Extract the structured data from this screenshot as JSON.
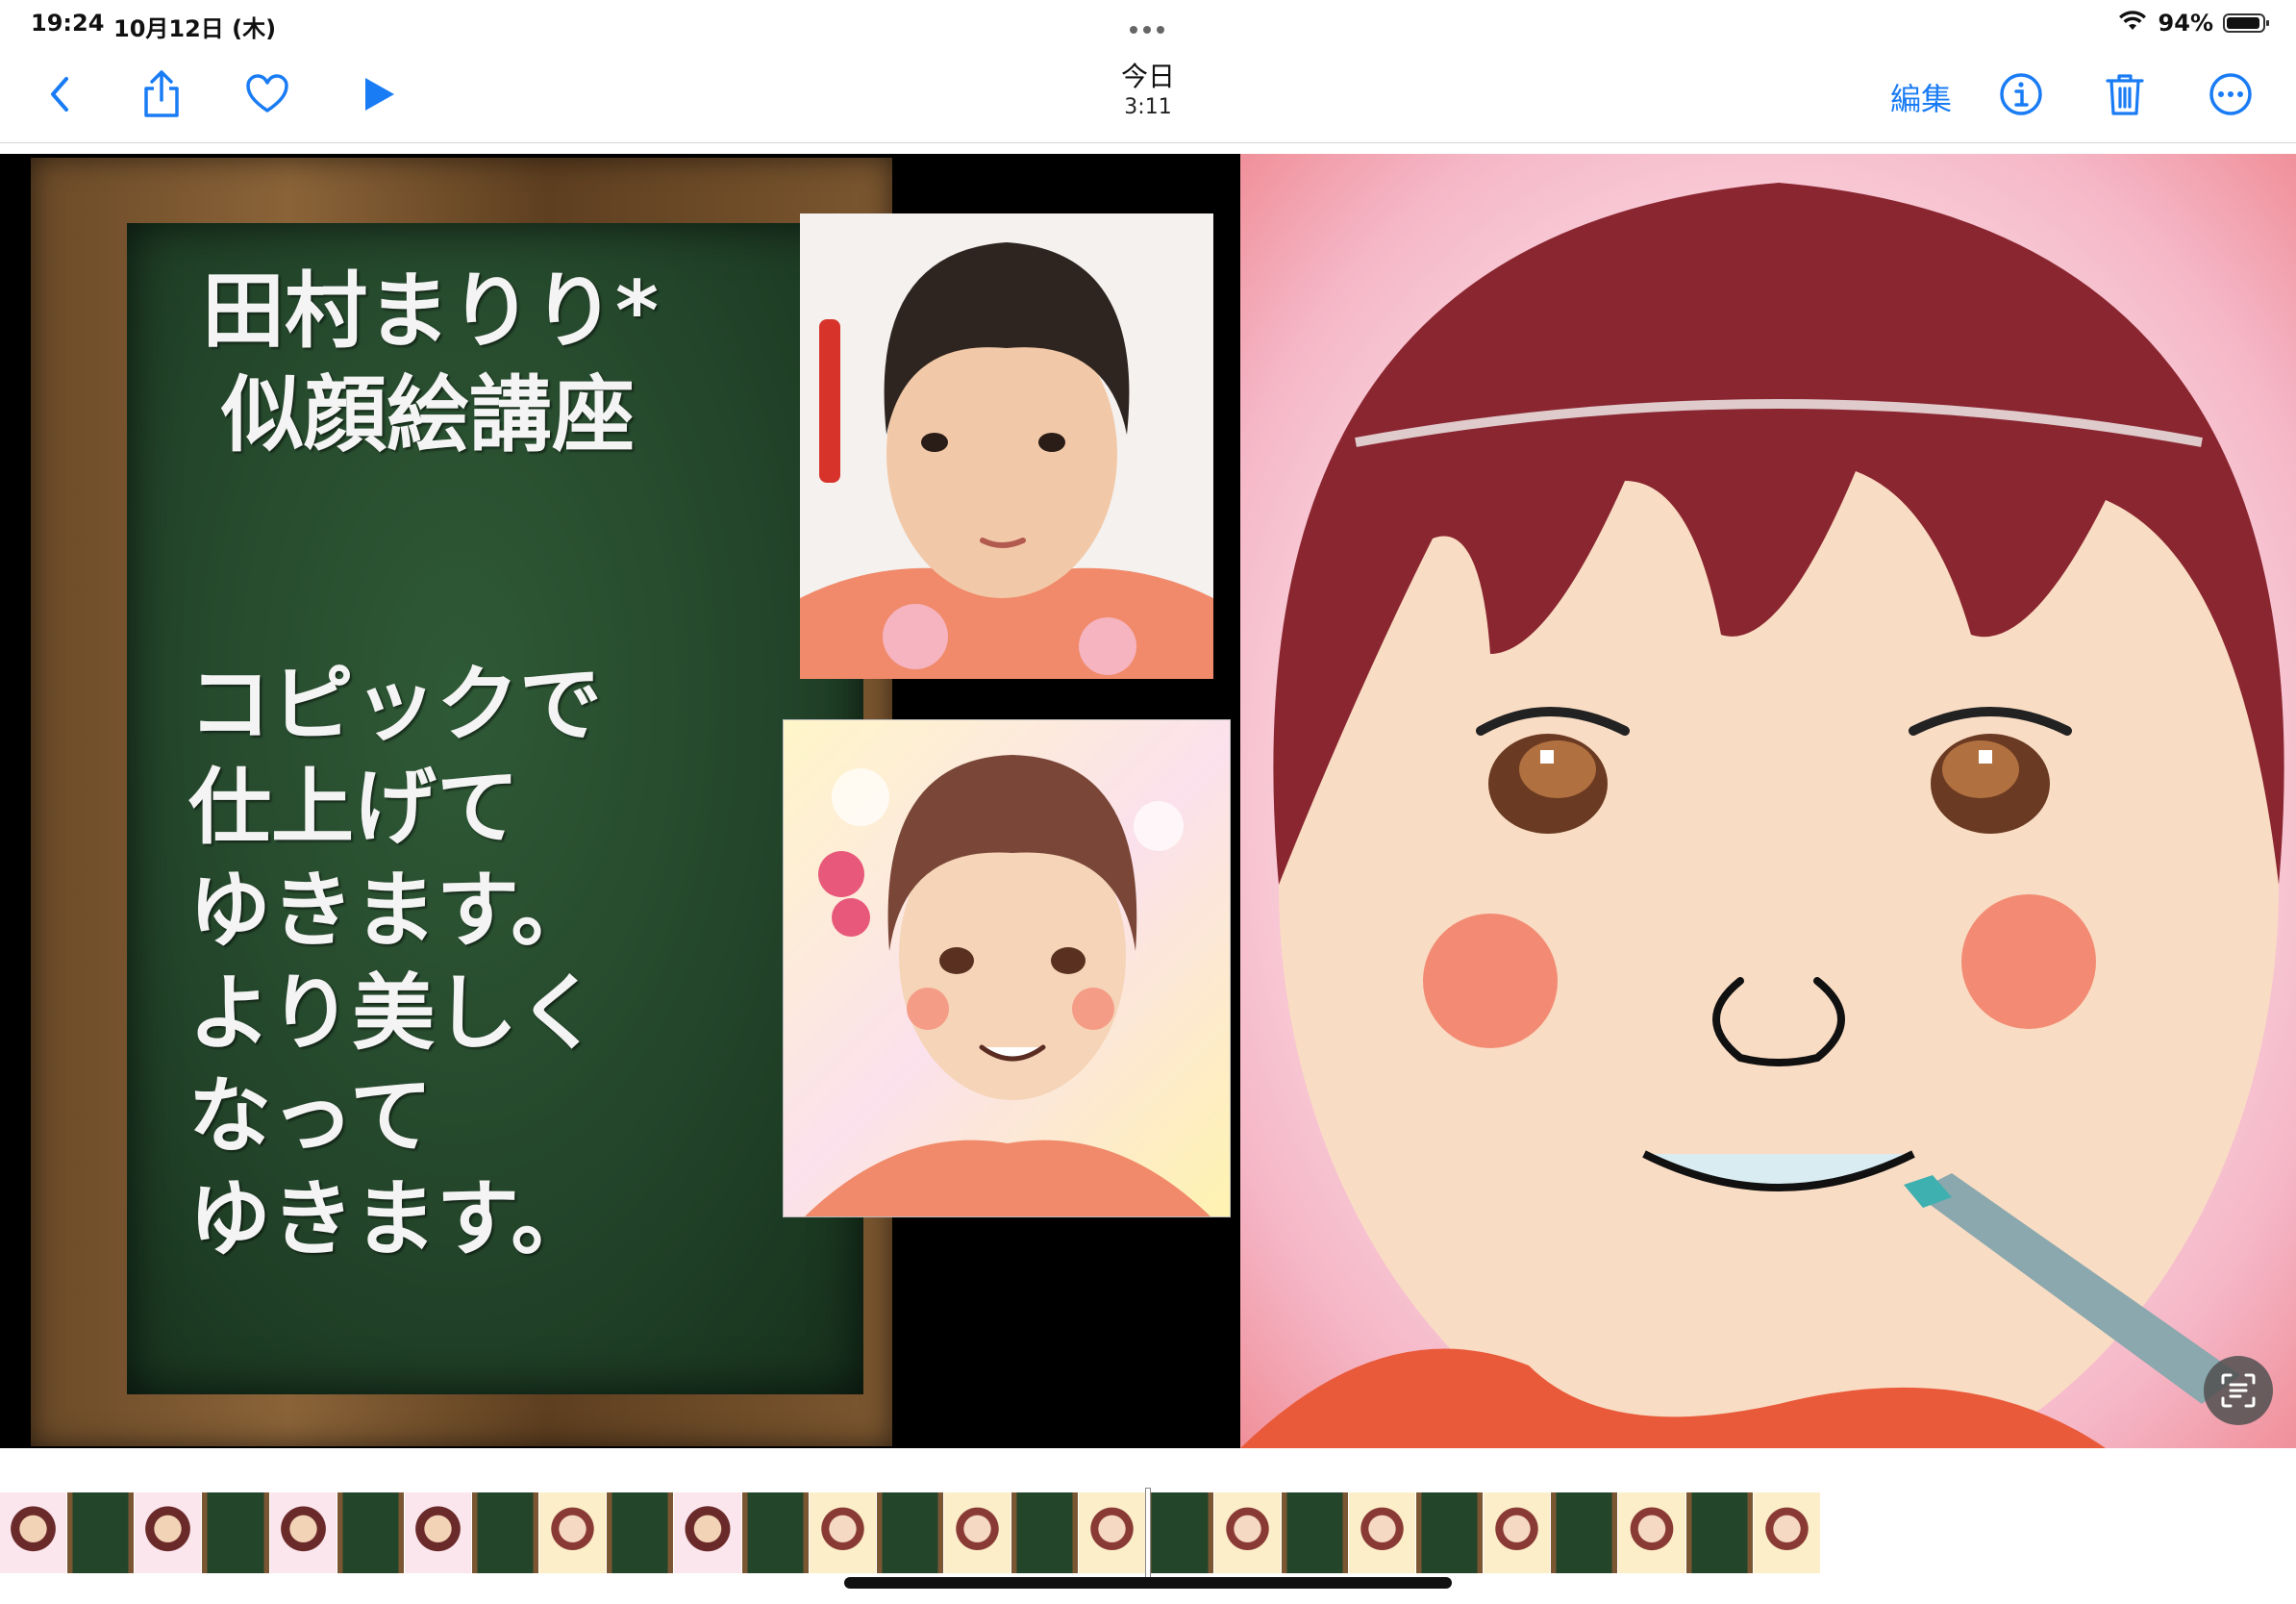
{
  "status_bar": {
    "time": "19:24",
    "date": "10月12日 (木)",
    "battery_percent": "94%",
    "battery_level": 0.94
  },
  "nav": {
    "title": "今日",
    "subtitle": "3:11",
    "edit_label": "編集"
  },
  "icons": {
    "back": "chevron-left-icon",
    "share": "share-icon",
    "favorite": "heart-icon",
    "play": "play-icon",
    "info": "info-icon",
    "delete": "trash-icon",
    "more": "ellipsis-circle-icon",
    "live_text": "live-text-icon",
    "wifi": "wifi-icon",
    "battery": "battery-icon"
  },
  "colors": {
    "accent": "#1a7cf5",
    "board_green": "#23452a",
    "frame_wood": "#7a5632"
  },
  "media": {
    "board_title_lines": [
      "田村まりり*",
      "似顔絵講座"
    ],
    "board_body_lines": [
      "コピックで",
      "仕上げて",
      "ゆきます。",
      "より美しく",
      "なって",
      "ゆきます。"
    ]
  },
  "filmstrip": {
    "thumbs": [
      "face",
      "board",
      "face",
      "board",
      "face",
      "board",
      "face",
      "board",
      "face2",
      "board",
      "face",
      "board",
      "face2",
      "board",
      "face2",
      "board",
      "face2",
      "board",
      "face2",
      "board",
      "face2",
      "board",
      "face2",
      "board",
      "face2",
      "board",
      "face2"
    ]
  }
}
